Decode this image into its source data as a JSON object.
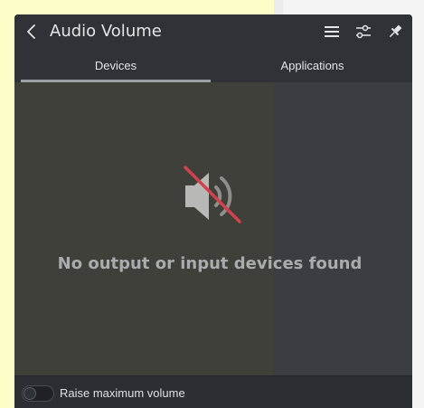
{
  "window": {
    "title": "Audio Volume"
  },
  "tabs": [
    {
      "label": "Devices",
      "selected": true
    },
    {
      "label": "Applications",
      "selected": false
    }
  ],
  "icons": {
    "back": "chevron-left-icon",
    "menu": "hamburger-menu-icon",
    "configure": "sliders-icon",
    "pin": "pin-icon",
    "empty_state": "speaker-muted-icon"
  },
  "empty_state": {
    "message": "No output or input devices found"
  },
  "footer": {
    "toggle_label": "Raise maximum volume",
    "toggle_on": false
  },
  "colors": {
    "mute_slash": "#d0424e",
    "speaker": "#b8b8b6"
  }
}
